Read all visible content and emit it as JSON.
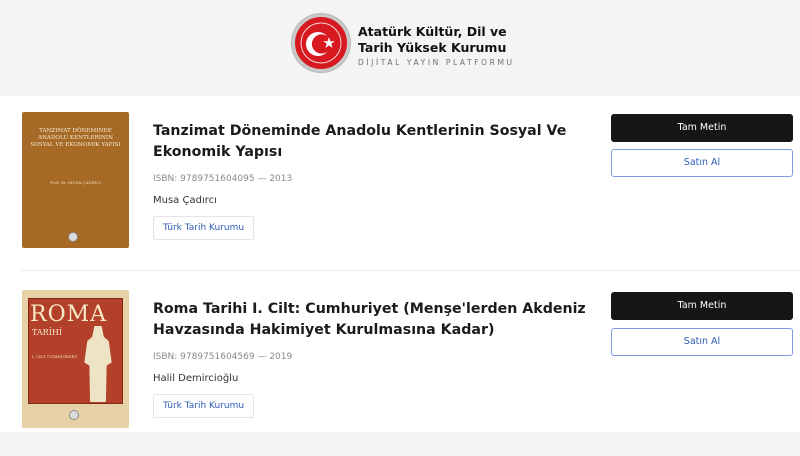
{
  "header": {
    "title": "Atatürk Kültür, Dil ve Tarih Yüksek Kurumu",
    "subtitle": "DİJİTAL YAYIN PLATFORMU",
    "logo_icon": "crescent-star-emblem"
  },
  "books": [
    {
      "title": "Tanzimat Döneminde Anadolu Kentlerinin Sosyal Ve Ekonomik Yapısı",
      "meta": "ISBN: 9789751604095 — 2013",
      "author": "Musa Çadırcı",
      "tag": "Türk Tarih Kurumu",
      "cover_title": "TANZIMAT DÖNEMINDE ANADOLU KENTLERININ SOSYAL VE EKONOMIK YAPISI",
      "cover_author": "Prof. Dr. MUSA ÇADIRCI",
      "primary_action": "Tam Metin",
      "secondary_action": "Satın Al"
    },
    {
      "title": "Roma Tarihi I. Cilt: Cumhuriyet (Menşe'lerden Akdeniz Havzasında Hakimiyet Kurulmasına Kadar)",
      "meta": "ISBN: 9789751604569 — 2019",
      "author": "Halil Demircioğlu",
      "tag": "Türk Tarih Kurumu",
      "cover_title": "ROMA",
      "cover_subtitle": "TARİHİ",
      "cover_note": "I. CILT CUMHURIYET",
      "primary_action": "Tam Metin",
      "secondary_action": "Satın Al"
    }
  ],
  "colors": {
    "primary_button": "#161616",
    "link_accent": "#2f5bb5",
    "emblem_red": "#d71920"
  }
}
